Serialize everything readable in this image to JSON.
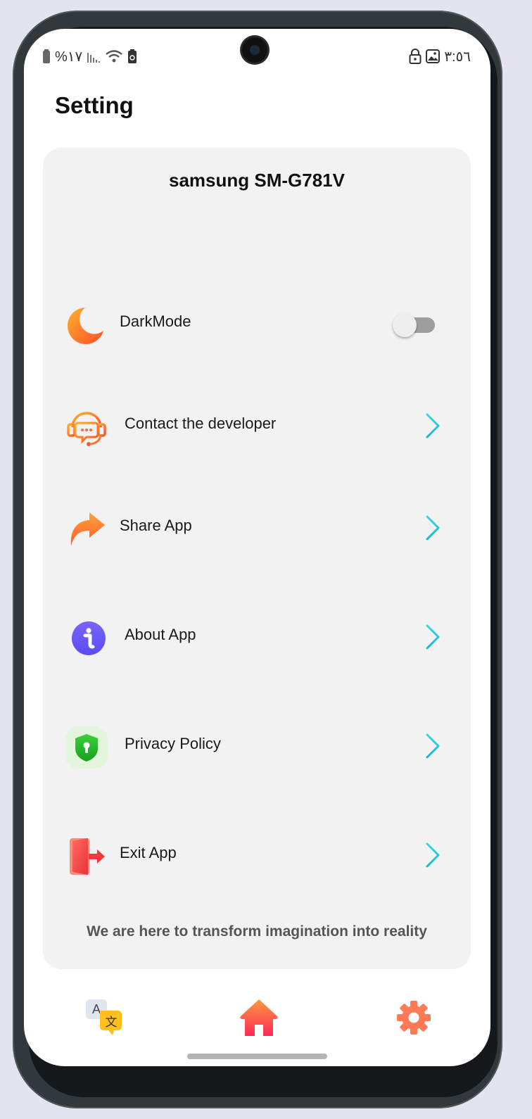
{
  "status_bar": {
    "battery_percent": "%١٧",
    "time": "٣:٥٦"
  },
  "page": {
    "title": "Setting"
  },
  "device": {
    "name": "samsung SM-G781V"
  },
  "menu": [
    {
      "id": "darkmode",
      "label": "DarkMode",
      "icon": "moon-icon",
      "control": "toggle",
      "toggle_on": false
    },
    {
      "id": "contact",
      "label": "Contact the developer",
      "icon": "support-chat-icon",
      "control": "chevron"
    },
    {
      "id": "share",
      "label": "Share App",
      "icon": "share-arrow-icon",
      "control": "chevron"
    },
    {
      "id": "about",
      "label": "About App",
      "icon": "info-icon",
      "control": "chevron"
    },
    {
      "id": "privacy",
      "label": "Privacy Policy",
      "icon": "shield-lock-icon",
      "control": "chevron"
    },
    {
      "id": "exit",
      "label": "Exit App",
      "icon": "exit-door-icon",
      "control": "chevron"
    }
  ],
  "tagline": "We are here to transform imagination into reality",
  "bottom_nav": [
    {
      "id": "language",
      "icon": "translate-icon",
      "active": false
    },
    {
      "id": "home",
      "icon": "home-icon",
      "active": true
    },
    {
      "id": "settings",
      "icon": "gear-icon",
      "active": false
    }
  ],
  "colors": {
    "chevron": "#1ec8d8",
    "card_background": "#f2f2f2",
    "accent_orange": "#ff7a2a",
    "home_active": "#ff2f55"
  }
}
